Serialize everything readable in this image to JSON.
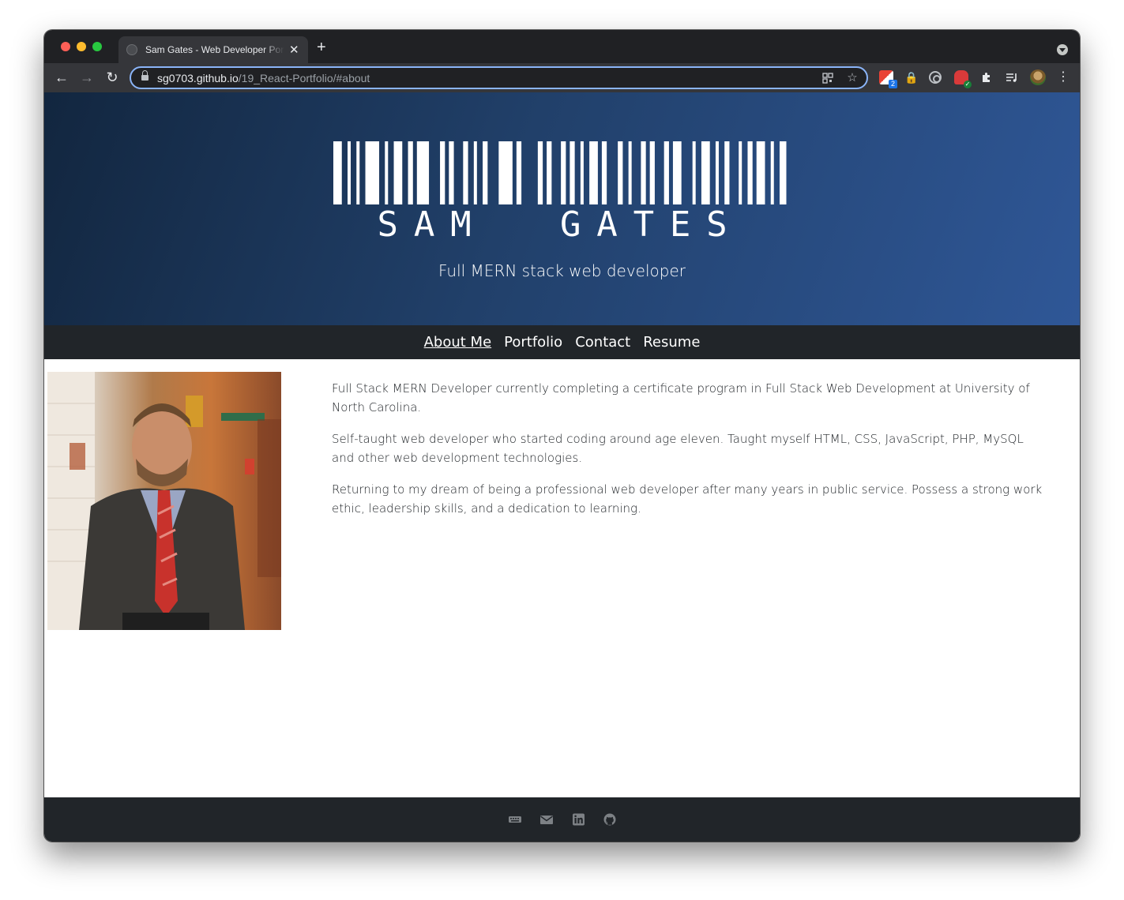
{
  "browser": {
    "tab_title": "Sam Gates - Web Developer Portfolio",
    "tab_close": "✕",
    "new_tab": "+",
    "url_host": "sg0703.github.io",
    "url_path": "/19_React-Portfolio/#about",
    "extension_badge_count": "2",
    "accent_color": "#8ab4f8"
  },
  "hero": {
    "logo_name": "SAM  GATES",
    "tagline": "Full MERN stack web developer",
    "gradient_colors": [
      "#12263f",
      "#2f5797"
    ]
  },
  "nav": {
    "items": [
      {
        "label": "About Me",
        "active": true
      },
      {
        "label": "Portfolio",
        "active": false
      },
      {
        "label": "Contact",
        "active": false
      },
      {
        "label": "Resume",
        "active": false
      }
    ]
  },
  "about": {
    "photo_alt": "Portrait photo",
    "paragraphs": [
      "Full Stack MERN Developer currently completing a certificate program in Full Stack Web Development at University of North Carolina.",
      "Self-taught web developer who started coding around age eleven. Taught myself HTML, CSS, JavaScript, PHP, MySQL and other web development technologies.",
      "Returning to my dream of being a professional web developer after many years in public service. Possess a strong work ethic, leadership skills, and a dedication to learning."
    ]
  },
  "footer": {
    "icons": [
      "keyboard-icon",
      "envelope-icon",
      "linkedin-icon",
      "github-icon"
    ],
    "icon_color": "#7d8185"
  }
}
